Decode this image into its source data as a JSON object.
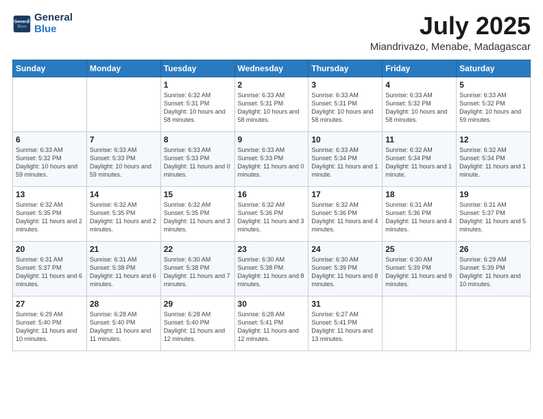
{
  "header": {
    "logo_line1": "General",
    "logo_line2": "Blue",
    "month": "July 2025",
    "location": "Miandrivazo, Menabe, Madagascar"
  },
  "weekdays": [
    "Sunday",
    "Monday",
    "Tuesday",
    "Wednesday",
    "Thursday",
    "Friday",
    "Saturday"
  ],
  "weeks": [
    [
      {
        "day": "",
        "info": ""
      },
      {
        "day": "",
        "info": ""
      },
      {
        "day": "1",
        "info": "Sunrise: 6:32 AM\nSunset: 5:31 PM\nDaylight: 10 hours and 58 minutes."
      },
      {
        "day": "2",
        "info": "Sunrise: 6:33 AM\nSunset: 5:31 PM\nDaylight: 10 hours and 58 minutes."
      },
      {
        "day": "3",
        "info": "Sunrise: 6:33 AM\nSunset: 5:31 PM\nDaylight: 10 hours and 58 minutes."
      },
      {
        "day": "4",
        "info": "Sunrise: 6:33 AM\nSunset: 5:32 PM\nDaylight: 10 hours and 58 minutes."
      },
      {
        "day": "5",
        "info": "Sunrise: 6:33 AM\nSunset: 5:32 PM\nDaylight: 10 hours and 59 minutes."
      }
    ],
    [
      {
        "day": "6",
        "info": "Sunrise: 6:33 AM\nSunset: 5:32 PM\nDaylight: 10 hours and 59 minutes."
      },
      {
        "day": "7",
        "info": "Sunrise: 6:33 AM\nSunset: 5:33 PM\nDaylight: 10 hours and 59 minutes."
      },
      {
        "day": "8",
        "info": "Sunrise: 6:33 AM\nSunset: 5:33 PM\nDaylight: 11 hours and 0 minutes."
      },
      {
        "day": "9",
        "info": "Sunrise: 6:33 AM\nSunset: 5:33 PM\nDaylight: 11 hours and 0 minutes."
      },
      {
        "day": "10",
        "info": "Sunrise: 6:33 AM\nSunset: 5:34 PM\nDaylight: 11 hours and 1 minute."
      },
      {
        "day": "11",
        "info": "Sunrise: 6:32 AM\nSunset: 5:34 PM\nDaylight: 11 hours and 1 minute."
      },
      {
        "day": "12",
        "info": "Sunrise: 6:32 AM\nSunset: 5:34 PM\nDaylight: 11 hours and 1 minute."
      }
    ],
    [
      {
        "day": "13",
        "info": "Sunrise: 6:32 AM\nSunset: 5:35 PM\nDaylight: 11 hours and 2 minutes."
      },
      {
        "day": "14",
        "info": "Sunrise: 6:32 AM\nSunset: 5:35 PM\nDaylight: 11 hours and 2 minutes."
      },
      {
        "day": "15",
        "info": "Sunrise: 6:32 AM\nSunset: 5:35 PM\nDaylight: 11 hours and 3 minutes."
      },
      {
        "day": "16",
        "info": "Sunrise: 6:32 AM\nSunset: 5:36 PM\nDaylight: 11 hours and 3 minutes."
      },
      {
        "day": "17",
        "info": "Sunrise: 6:32 AM\nSunset: 5:36 PM\nDaylight: 11 hours and 4 minutes."
      },
      {
        "day": "18",
        "info": "Sunrise: 6:31 AM\nSunset: 5:36 PM\nDaylight: 11 hours and 4 minutes."
      },
      {
        "day": "19",
        "info": "Sunrise: 6:31 AM\nSunset: 5:37 PM\nDaylight: 11 hours and 5 minutes."
      }
    ],
    [
      {
        "day": "20",
        "info": "Sunrise: 6:31 AM\nSunset: 5:37 PM\nDaylight: 11 hours and 6 minutes."
      },
      {
        "day": "21",
        "info": "Sunrise: 6:31 AM\nSunset: 5:38 PM\nDaylight: 11 hours and 6 minutes."
      },
      {
        "day": "22",
        "info": "Sunrise: 6:30 AM\nSunset: 5:38 PM\nDaylight: 11 hours and 7 minutes."
      },
      {
        "day": "23",
        "info": "Sunrise: 6:30 AM\nSunset: 5:38 PM\nDaylight: 11 hours and 8 minutes."
      },
      {
        "day": "24",
        "info": "Sunrise: 6:30 AM\nSunset: 5:39 PM\nDaylight: 11 hours and 8 minutes."
      },
      {
        "day": "25",
        "info": "Sunrise: 6:30 AM\nSunset: 5:39 PM\nDaylight: 11 hours and 9 minutes."
      },
      {
        "day": "26",
        "info": "Sunrise: 6:29 AM\nSunset: 5:39 PM\nDaylight: 11 hours and 10 minutes."
      }
    ],
    [
      {
        "day": "27",
        "info": "Sunrise: 6:29 AM\nSunset: 5:40 PM\nDaylight: 11 hours and 10 minutes."
      },
      {
        "day": "28",
        "info": "Sunrise: 6:28 AM\nSunset: 5:40 PM\nDaylight: 11 hours and 11 minutes."
      },
      {
        "day": "29",
        "info": "Sunrise: 6:28 AM\nSunset: 5:40 PM\nDaylight: 11 hours and 12 minutes."
      },
      {
        "day": "30",
        "info": "Sunrise: 6:28 AM\nSunset: 5:41 PM\nDaylight: 11 hours and 12 minutes."
      },
      {
        "day": "31",
        "info": "Sunrise: 6:27 AM\nSunset: 5:41 PM\nDaylight: 11 hours and 13 minutes."
      },
      {
        "day": "",
        "info": ""
      },
      {
        "day": "",
        "info": ""
      }
    ]
  ]
}
